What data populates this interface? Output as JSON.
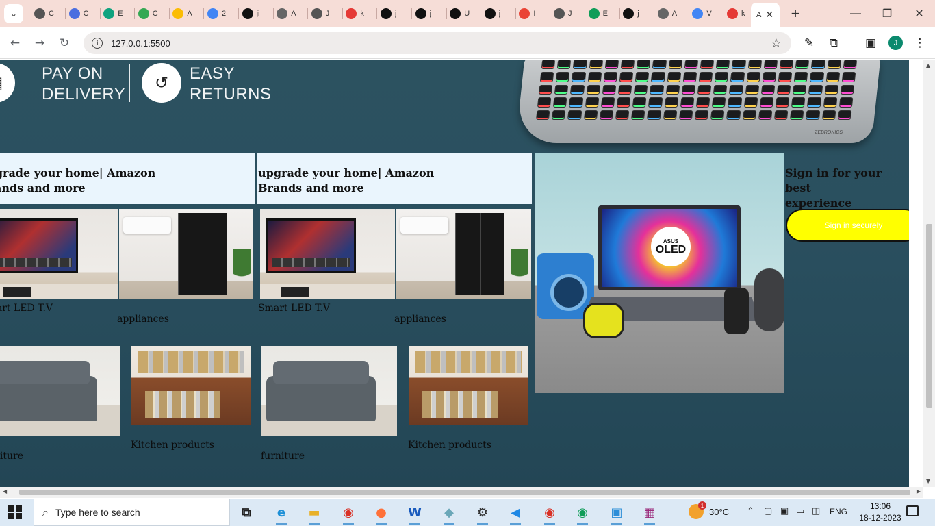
{
  "browser": {
    "tabs": [
      {
        "icon": "document-icon",
        "title": "C",
        "color": "#555555"
      },
      {
        "icon": "circle-icon",
        "title": "C",
        "color": "#4a6ee0"
      },
      {
        "icon": "openai-icon",
        "title": "E",
        "color": "#10a37f"
      },
      {
        "icon": "meet-icon",
        "title": "C",
        "color": "#34a853"
      },
      {
        "icon": "chat-icon",
        "title": "A",
        "color": "#fbbc04"
      },
      {
        "icon": "drive-icon",
        "title": "2",
        "color": "#4285f4"
      },
      {
        "icon": "github-icon",
        "title": "ji",
        "color": "#111111"
      },
      {
        "icon": "globe-icon",
        "title": "A",
        "color": "#666666"
      },
      {
        "icon": "document-icon",
        "title": "J",
        "color": "#555555"
      },
      {
        "icon": "pdf-icon",
        "title": "k",
        "color": "#e53935"
      },
      {
        "icon": "github-icon",
        "title": "j",
        "color": "#111111"
      },
      {
        "icon": "github-icon",
        "title": "j",
        "color": "#111111"
      },
      {
        "icon": "github-icon",
        "title": "U",
        "color": "#111111"
      },
      {
        "icon": "github-icon",
        "title": "j",
        "color": "#111111"
      },
      {
        "icon": "gmail-icon",
        "title": "I",
        "color": "#ea4335"
      },
      {
        "icon": "document-icon",
        "title": "J",
        "color": "#555555"
      },
      {
        "icon": "sheets-icon",
        "title": "E",
        "color": "#0f9d58"
      },
      {
        "icon": "github-icon",
        "title": "j",
        "color": "#111111"
      },
      {
        "icon": "globe-icon",
        "title": "A",
        "color": "#666666"
      },
      {
        "icon": "chrome-icon",
        "title": "V",
        "color": "#4285f4"
      },
      {
        "icon": "pdf-icon",
        "title": "k",
        "color": "#e53935"
      }
    ],
    "active_tab_title": "A",
    "url": "127.0.0.1:5500",
    "profile_initial": "J"
  },
  "page": {
    "hero": {
      "pay_text": "PAY ON\nDELIVERY",
      "returns_text": "EASY\nRETURNS",
      "keyboard_brand": "ZEBRONICS"
    },
    "cards": [
      {
        "title": "upgrade your home| Amazon\nBrands and more",
        "products": [
          {
            "label": "Smart LED T.V",
            "image": "tv"
          },
          {
            "label": "appliances",
            "image": "appliances"
          },
          {
            "label": "furniture",
            "image": "sofa"
          },
          {
            "label": "Kitchen products",
            "image": "kitchen"
          }
        ]
      },
      {
        "title": "upgrade your home| Amazon\nBrands and more",
        "products": [
          {
            "label": "Smart LED T.V",
            "image": "tv"
          },
          {
            "label": "appliances",
            "image": "appliances"
          },
          {
            "label": "furniture",
            "image": "sofa"
          },
          {
            "label": "Kitchen products",
            "image": "kitchen"
          }
        ]
      }
    ],
    "laptop_promo": {
      "logo_small": "ASUS",
      "logo_big": "OLED"
    },
    "signin": {
      "title": "Sign in for your best\nexperience",
      "button_label": "Sign in securely"
    }
  },
  "taskbar": {
    "search_placeholder": "Type here to search",
    "apps": [
      {
        "name": "task-view",
        "glyph": "⧉",
        "color": "#222222"
      },
      {
        "name": "edge",
        "glyph": "e",
        "color": "#1c8fd6"
      },
      {
        "name": "file-explorer",
        "glyph": "▬",
        "color": "#e8b12a"
      },
      {
        "name": "chrome",
        "glyph": "◉",
        "color": "#d93025"
      },
      {
        "name": "firefox",
        "glyph": "●",
        "color": "#ff7139"
      },
      {
        "name": "word",
        "glyph": "W",
        "color": "#185abd"
      },
      {
        "name": "app",
        "glyph": "◆",
        "color": "#6aa7b8"
      },
      {
        "name": "settings",
        "glyph": "⚙",
        "color": "#333333"
      },
      {
        "name": "vscode",
        "glyph": "◀",
        "color": "#1e88e5"
      },
      {
        "name": "chrome-profile-1",
        "glyph": "◉",
        "color": "#d93025"
      },
      {
        "name": "chrome-profile-2",
        "glyph": "◉",
        "color": "#0f9d58"
      },
      {
        "name": "photos",
        "glyph": "▣",
        "color": "#2c8ed8"
      },
      {
        "name": "winrar",
        "glyph": "▦",
        "color": "#9b2c7c"
      }
    ],
    "weather_temp": "30°C",
    "weather_badge": "1",
    "language": "ENG",
    "time": "13:06",
    "date": "18-12-2023"
  }
}
